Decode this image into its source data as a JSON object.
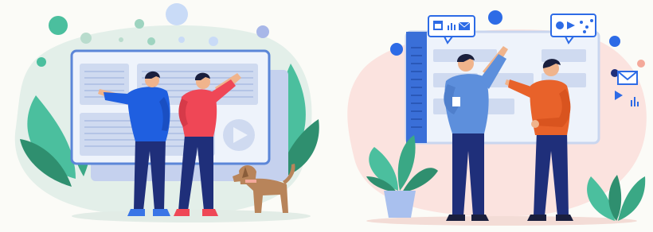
{
  "colors": {
    "background": "#fbfbf7",
    "blob_left": "#e3efe9",
    "blob_right": "#fbe3df",
    "window_border": "#5b86d8",
    "window_fill": "#eef3fb",
    "window_panel": "#cfdaf0",
    "teal": "#4bbf9e",
    "green_dark": "#2f8f6f",
    "blue_shirt": "#1f5fe0",
    "red_shirt": "#ef4756",
    "orange_shirt": "#e8622a",
    "light_blue_shirt": "#5d8fdc",
    "navy_pants": "#1f2f7a",
    "dog": "#b8845a",
    "accent_blue": "#2d6be6",
    "accent_salmon": "#f4a99a"
  },
  "icons": [
    "play-icon",
    "mail-icon",
    "chart-icon",
    "calendar-icon",
    "info-icon",
    "speech-bubble-icon"
  ]
}
